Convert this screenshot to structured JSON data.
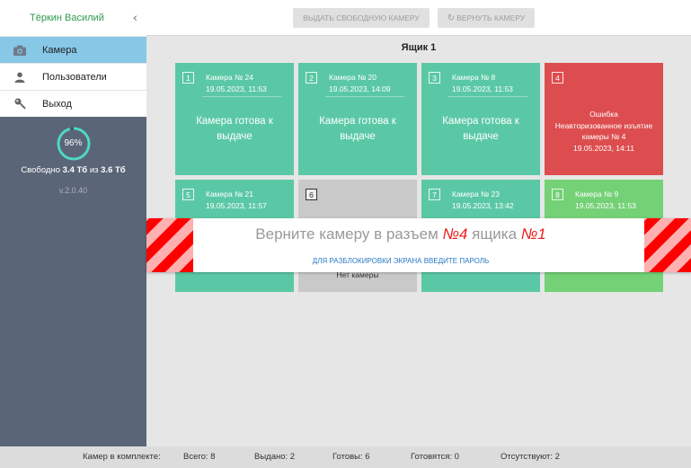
{
  "sidebar": {
    "user_name": "Тёркин Василий",
    "collapse_glyph": "‹",
    "items": [
      {
        "label": "Камера",
        "icon": "camera-icon",
        "active": true
      },
      {
        "label": "Пользователи",
        "icon": "user-icon",
        "active": false
      },
      {
        "label": "Выход",
        "icon": "key-icon",
        "active": false
      }
    ],
    "storage": {
      "percent_text": "96%",
      "percent": 96,
      "free_label": "Свободно",
      "free_value": "3.4 Тб",
      "of_label": "из",
      "total_value": "3.6 Тб"
    },
    "version": "v.2.0.40"
  },
  "toolbar": {
    "issue_label": "Выдать свободную камеру",
    "return_label": "Вернуть камеру",
    "return_icon": "refresh-icon"
  },
  "main": {
    "title": "Ящик 1",
    "cells": [
      {
        "num": "1",
        "camera": "Камера № 24",
        "date": "19.05.2023, 11:53",
        "status": "Камера готова к выдаче",
        "state": "ready",
        "color": "#5bc8a5"
      },
      {
        "num": "2",
        "camera": "Камера № 20",
        "date": "19.05.2023, 14:09",
        "status": "Камера готова к выдаче",
        "state": "ready",
        "color": "#5bc8a5"
      },
      {
        "num": "3",
        "camera": "Камера № 8",
        "date": "19.05.2023, 11:53",
        "status": "Камера готова к выдаче",
        "state": "ready",
        "color": "#5bc8a5"
      },
      {
        "num": "4",
        "error_title": "Ошибка",
        "error_text": "Неавторизованное изъятие камеры № 4",
        "error_date": "19.05.2023, 14:11",
        "state": "error",
        "color": "#dd4d4f"
      },
      {
        "num": "5",
        "camera": "Камера № 21",
        "date": "19.05.2023, 11:57",
        "state": "ready",
        "color": "#5bc8a5"
      },
      {
        "num": "6",
        "status": "Нет камеры",
        "state": "empty",
        "color": "#c9c9c9"
      },
      {
        "num": "7",
        "camera": "Камера № 23",
        "date": "19.05.2023, 13:42",
        "state": "ready",
        "color": "#5bc8a5"
      },
      {
        "num": "8",
        "camera": "Камера № 9",
        "date": "19.05.2023, 11:53",
        "state": "charging",
        "color": "#74d176"
      }
    ]
  },
  "overlay": {
    "message_prefix": "Верните камеру в разъем",
    "slot": "№4",
    "message_middle": "ящика",
    "box": "№1",
    "unlock_link": "ДЛЯ РАЗБЛОКИРОВКИ ЭКРАНА ВВЕДИТЕ ПАРОЛЬ",
    "stripe_colors": [
      "#ff0000",
      "#ffb0b0"
    ]
  },
  "footer": {
    "kit_label": "Камер в комплекте:",
    "total": "Всего: 8",
    "issued": "Выдано: 2",
    "ready": "Готовы: 6",
    "preparing": "Готовятся: 0",
    "missing": "Отсутствуют: 2"
  }
}
